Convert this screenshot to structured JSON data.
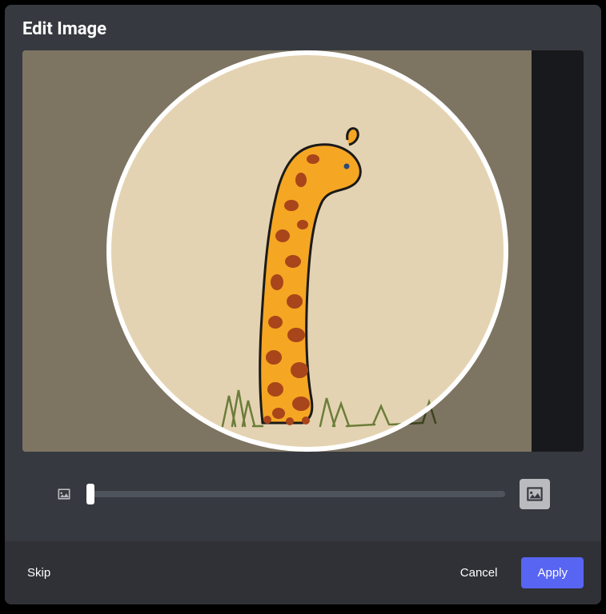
{
  "header": {
    "title": "Edit Image"
  },
  "slider": {
    "value": 0,
    "min": 0,
    "max": 100
  },
  "icons": {
    "zoom_out": "image-small-icon",
    "zoom_in": "image-large-icon"
  },
  "footer": {
    "skip_label": "Skip",
    "cancel_label": "Cancel",
    "apply_label": "Apply"
  },
  "colors": {
    "modal_bg": "#36393f",
    "footer_bg": "#2f3136",
    "primary": "#5865f2",
    "image_bg": "#e4d3b2",
    "giraffe_body": "#f5a623",
    "giraffe_spots": "#a8451a",
    "giraffe_outline": "#1a1a1a",
    "grass": "#6b7d3a"
  }
}
